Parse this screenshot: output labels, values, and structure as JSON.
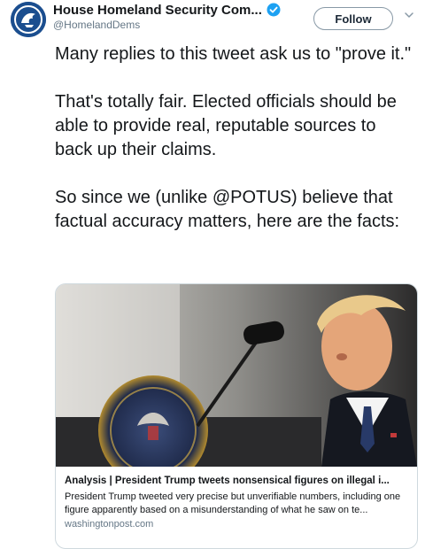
{
  "header": {
    "display_name": "House Homeland Security Com...",
    "handle": "@HomelandDems",
    "follow_label": "Follow"
  },
  "tweet": {
    "paragraphs": [
      "Many replies to this tweet ask us to \"prove it.\"",
      "That's totally fair. Elected officials should be able to provide real, reputable sources to back up their claims.",
      "So since we (unlike @POTUS) believe that factual accuracy matters, here are the facts:"
    ]
  },
  "card": {
    "title": "Analysis | President Trump tweets nonsensical figures on illegal i...",
    "description": "President Trump tweeted very precise but unverifiable numbers, including one figure apparently based on a misunderstanding of what he saw on te...",
    "domain": "washingtonpost.com"
  },
  "colors": {
    "verified_blue": "#1da1f2",
    "avatar_blue": "#1b4e8f",
    "muted_text": "#657786"
  },
  "icons": {
    "verified": "verified-badge-icon",
    "caret": "chevron-down-icon",
    "avatar": "committee-seal-avatar"
  }
}
